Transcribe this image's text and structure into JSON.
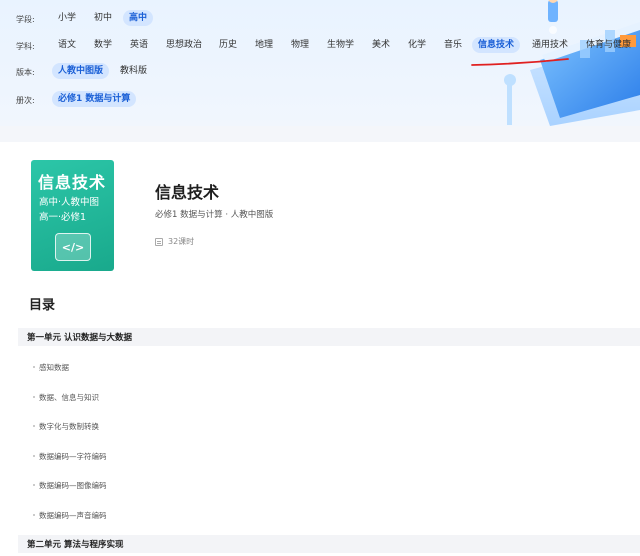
{
  "filters": {
    "stage": {
      "label": "学段:",
      "options": [
        "小学",
        "初中",
        "高中"
      ],
      "selected": "高中"
    },
    "subject": {
      "label": "学科:",
      "options": [
        "语文",
        "数学",
        "英语",
        "思想政治",
        "历史",
        "地理",
        "物理",
        "生物学",
        "美术",
        "化学",
        "音乐",
        "信息技术",
        "通用技术",
        "体育与健康"
      ],
      "selected": "信息技术"
    },
    "edition": {
      "label": "版本:",
      "options": [
        "人教中图版",
        "教科版"
      ],
      "selected": "人教中图版"
    },
    "volume": {
      "label": "册次:",
      "options": [
        "必修1 数据与计算"
      ],
      "selected": "必修1 数据与计算"
    }
  },
  "colors": {
    "accent": "#1a5fd6",
    "chip_active_bg": "#d3e5ff",
    "annotation_red": "#e02020",
    "cover_green": "#19a98c"
  },
  "course": {
    "cover": {
      "title": "信息技术",
      "line1": "高中·人教中图",
      "line2": "高一·必修1",
      "icon": "code-icon",
      "icon_text": "</>"
    },
    "title": "信息技术",
    "subtitle": "必修1 数据与计算 · 人教中图版",
    "hours": "32课时",
    "hours_icon": "book-icon"
  },
  "toc": {
    "heading": "目录",
    "units": [
      {
        "title": "第一单元 认识数据与大数据",
        "lessons": [
          "感知数据",
          "数据、信息与知识",
          "数字化与数制转换",
          "数据编码—字符编码",
          "数据编码—图像编码",
          "数据编码—声音编码"
        ]
      },
      {
        "title": "第二单元 算法与程序实现",
        "lessons": []
      }
    ]
  }
}
